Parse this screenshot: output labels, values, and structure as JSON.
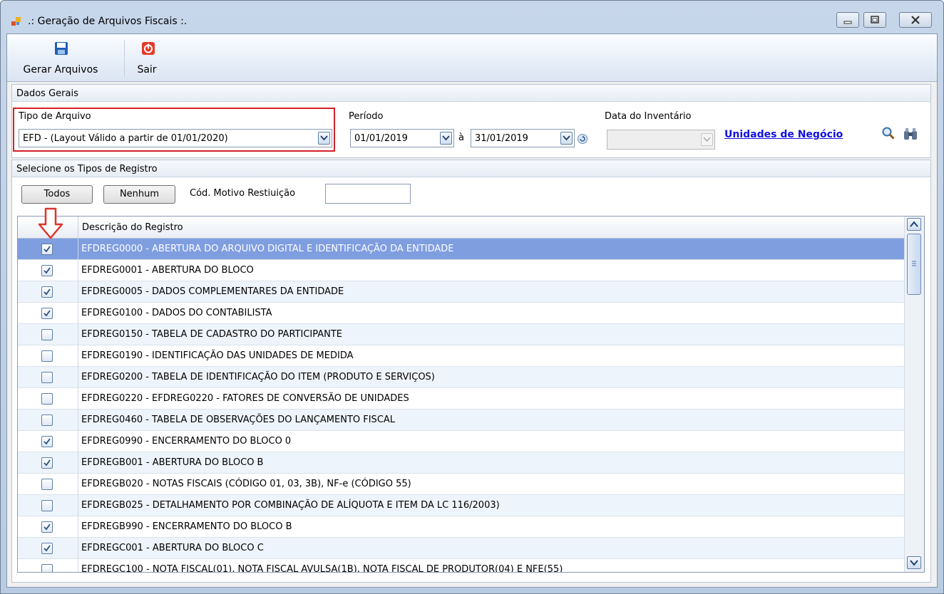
{
  "window": {
    "title": ".: Geração de Arquivos Fiscais :.",
    "controls": [
      "minimize-icon",
      "maximize-icon",
      "close-icon"
    ]
  },
  "toolbar": {
    "generate_label": "Gerar Arquivos",
    "generate_icon": "floppy-disk-icon",
    "exit_label": "Sair",
    "exit_icon": "power-icon"
  },
  "general": {
    "header": "Dados Gerais",
    "file_type_label": "Tipo de Arquivo",
    "file_type_value": "EFD - (Layout Válido a partir de 01/01/2020)",
    "period_label": "Período",
    "period_start": "01/01/2019",
    "period_sep": "à",
    "period_end": "31/01/2019",
    "inventory_label": "Data do Inventário",
    "inventory_value": "",
    "business_units_link": "Unidades de Negócio"
  },
  "records": {
    "header": "Selecione os Tipos de Registro",
    "all_button": "Todos",
    "none_button": "Nenhum",
    "reason_code_label": "Cód. Motivo Restiuição",
    "reason_code_value": "",
    "column_description": "Descrição do Registro",
    "rows": [
      {
        "checked": true,
        "description": "EFDREG0000 - ABERTURA DO ARQUIVO DIGITAL E IDENTIFICAÇÃO DA ENTIDADE",
        "selected": true
      },
      {
        "checked": true,
        "description": "EFDREG0001 - ABERTURA DO BLOCO"
      },
      {
        "checked": true,
        "description": "EFDREG0005 - DADOS COMPLEMENTARES DA ENTIDADE"
      },
      {
        "checked": true,
        "description": "EFDREG0100 - DADOS DO CONTABILISTA"
      },
      {
        "checked": false,
        "description": "EFDREG0150 - TABELA DE CADASTRO DO PARTICIPANTE"
      },
      {
        "checked": false,
        "description": "EFDREG0190 - IDENTIFICAÇÃO DAS UNIDADES DE MEDIDA"
      },
      {
        "checked": false,
        "description": "EFDREG0200 - TABELA DE IDENTIFICAÇÃO DO ITEM (PRODUTO E SERVIÇOS)"
      },
      {
        "checked": false,
        "description": "EFDREG0220 - EFDREG0220 - FATORES DE CONVERSÃO DE UNIDADES"
      },
      {
        "checked": false,
        "description": "EFDREG0460 - TABELA DE OBSERVAÇÕES DO LANÇAMENTO FISCAL"
      },
      {
        "checked": true,
        "description": "EFDREG0990 - ENCERRAMENTO DO BLOCO 0"
      },
      {
        "checked": true,
        "description": "EFDREGB001 - ABERTURA DO BLOCO B"
      },
      {
        "checked": false,
        "description": "EFDREGB020 - NOTAS FISCAIS (CÓDIGO 01, 03, 3B), NF-e (CÓDIGO 55)"
      },
      {
        "checked": false,
        "description": "EFDREGB025 - DETALHAMENTO POR COMBINAÇÃO DE ALÍQUOTA E ITEM DA LC 116/2003)"
      },
      {
        "checked": true,
        "description": "EFDREGB990 - ENCERRAMENTO DO BLOCO B"
      },
      {
        "checked": true,
        "description": "EFDREGC001 - ABERTURA DO BLOCO C"
      },
      {
        "checked": false,
        "description": "EFDREGC100 - NOTA FISCAL(01), NOTA FISCAL AVULSA(1B), NOTA FISCAL DE PRODUTOR(04) E NFE(55)"
      }
    ]
  },
  "colors": {
    "selected_row": "#7f9ee0",
    "highlight_border": "#d62128",
    "link": "#1010e0"
  }
}
